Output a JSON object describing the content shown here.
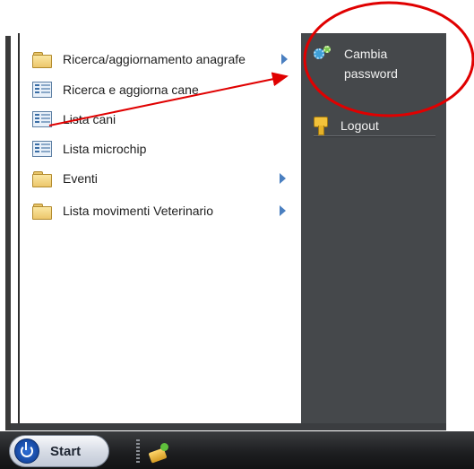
{
  "start_menu": {
    "left_items": [
      {
        "label": "Ricerca/aggiornamento anagrafe",
        "icon": "folder-icon",
        "has_submenu": true
      },
      {
        "label": "Ricerca e aggiorna cane",
        "icon": "list-icon",
        "has_submenu": false
      },
      {
        "label": "Lista cani",
        "icon": "list-icon",
        "has_submenu": false
      },
      {
        "label": "Lista microchip",
        "icon": "list-icon",
        "has_submenu": false
      },
      {
        "label": "Eventi",
        "icon": "folder-icon",
        "has_submenu": true
      },
      {
        "label": "Lista movimenti Veterinario",
        "icon": "folder-icon",
        "has_submenu": true
      }
    ],
    "right_items": [
      {
        "label_line1": "Cambia",
        "label_line2": "password",
        "icon": "gear-icon"
      },
      {
        "label": "Logout",
        "icon": "key-icon"
      }
    ]
  },
  "taskbar": {
    "start_label": "Start",
    "quicklaunch_icon": "paint-icon"
  },
  "colors": {
    "menu_right_bg": "#45484b",
    "annotation_red": "#e00000",
    "submenu_arrow": "#4a7fc0"
  }
}
